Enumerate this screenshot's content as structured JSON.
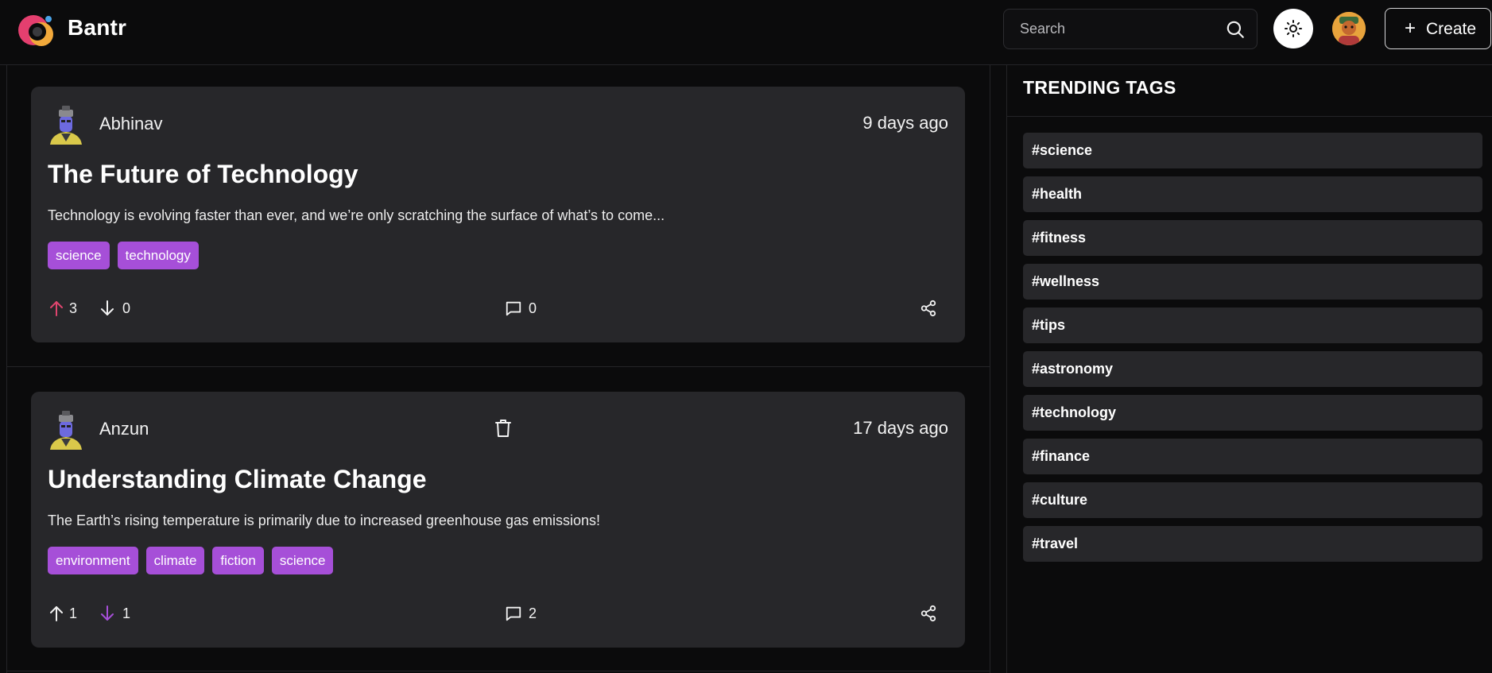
{
  "header": {
    "brand": "Bantr",
    "search_placeholder": "Search",
    "create_label": "Create",
    "icons": [
      "logo-icon",
      "search-icon",
      "sun-icon",
      "user-avatar"
    ]
  },
  "posts": [
    {
      "author": "Abhinav",
      "time": "9 days ago",
      "title": "The Future of Technology",
      "content": "Technology is evolving faster than ever, and we’re only scratching the surface of what’s to come...",
      "tags": [
        "science",
        "technology"
      ],
      "upvotes": "3",
      "downvotes": "0",
      "comments": "0",
      "vote_state": "up"
    },
    {
      "author": "Anzun",
      "time": "17 days ago",
      "title": "Understanding Climate Change",
      "content": "The Earth’s rising temperature is primarily due to increased greenhouse gas emissions!",
      "tags": [
        "environment",
        "climate",
        "fiction",
        "science"
      ],
      "upvotes": "1",
      "downvotes": "1",
      "comments": "2",
      "vote_state": "down"
    }
  ],
  "sidebar": {
    "title": "TRENDING TAGS",
    "tags": [
      "#science",
      "#health",
      "#fitness",
      "#wellness",
      "#tips",
      "#astronomy",
      "#technology",
      "#finance",
      "#culture",
      "#travel"
    ]
  },
  "colors": {
    "tag_bg": "#a64fd8",
    "upvote_active": "#e0456f",
    "downvote_active": "#a64fd8",
    "card_bg": "#27272a"
  }
}
